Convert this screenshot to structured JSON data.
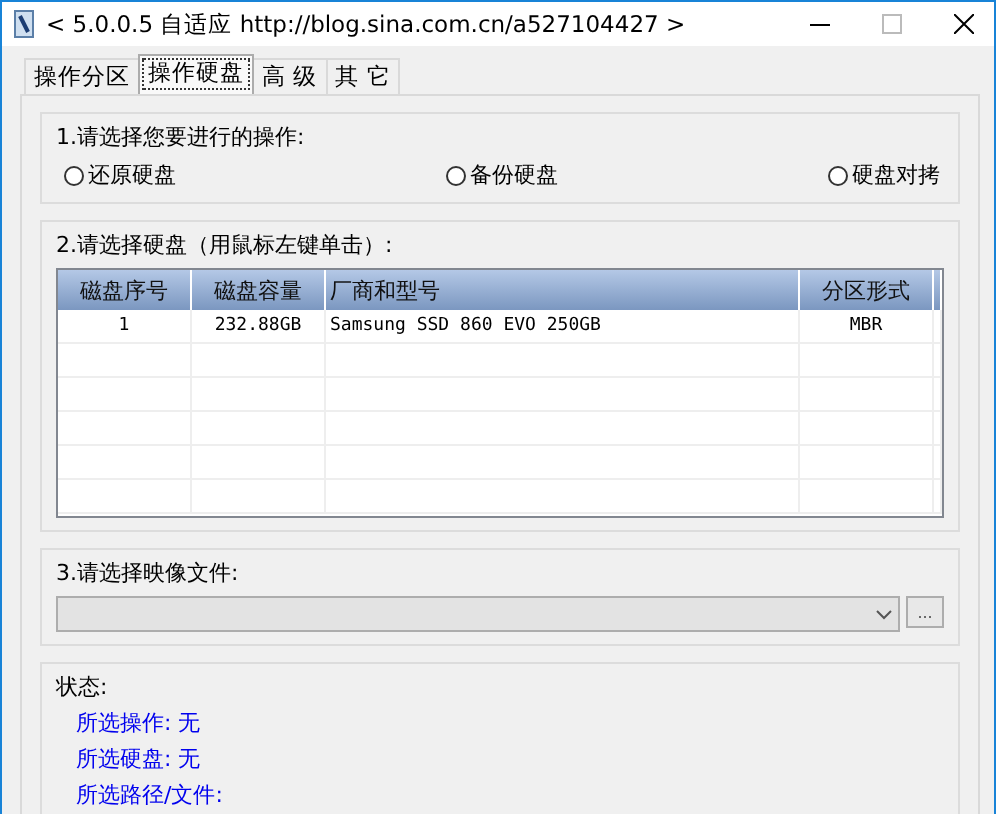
{
  "window": {
    "title": "< 5.0.0.5 自适应 http://blog.sina.com.cn/a527104427 >"
  },
  "tabs": [
    {
      "label": "操作分区",
      "selected": false
    },
    {
      "label": "操作硬盘",
      "selected": true
    },
    {
      "label": "高 级",
      "selected": false
    },
    {
      "label": "其 它",
      "selected": false
    }
  ],
  "operation_group": {
    "label": "1.请选择您要进行的操作:",
    "options": [
      {
        "label": "还原硬盘",
        "selected": false
      },
      {
        "label": "备份硬盘",
        "selected": false
      },
      {
        "label": "硬盘对拷",
        "selected": false
      }
    ]
  },
  "disk_group": {
    "label": "2.请选择硬盘（用鼠标左键单击）:",
    "table": {
      "columns": [
        "磁盘序号",
        "磁盘容量",
        "厂商和型号",
        "分区形式"
      ],
      "rows": [
        [
          "1",
          "232.88GB",
          "Samsung SSD 860 EVO 250GB",
          "MBR"
        ]
      ]
    }
  },
  "image_group": {
    "label": "3.请选择映像文件:",
    "browse_button": "..."
  },
  "status": {
    "label": "状态:",
    "lines": [
      "所选操作: 无",
      "所选硬盘: 无",
      "所选路径/文件:"
    ]
  }
}
